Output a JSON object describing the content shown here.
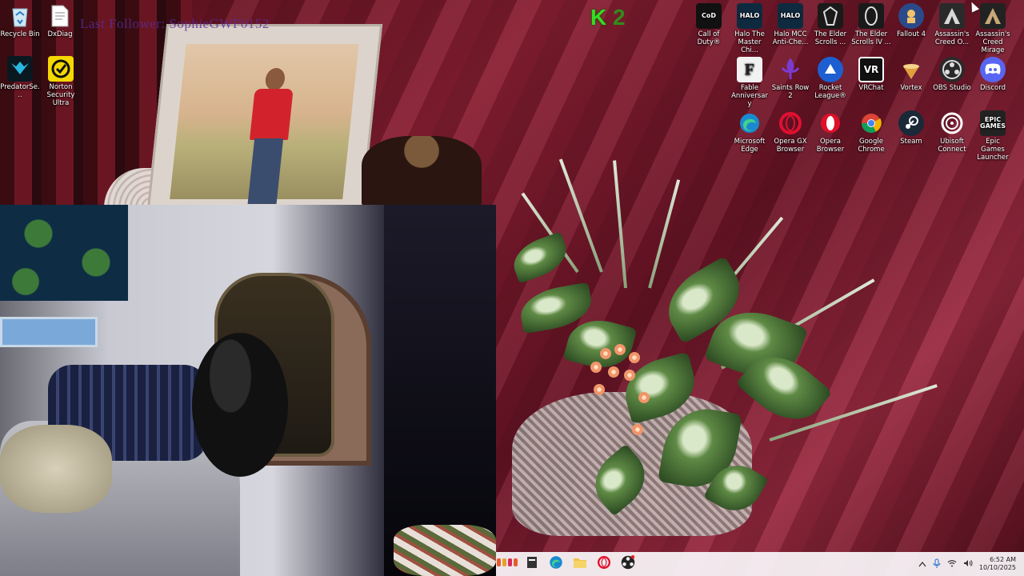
{
  "overlay": {
    "follower_text": "Last Follower: SophieGWF0152",
    "logo_letter": "K",
    "logo_number": "2"
  },
  "desktop_icons_left": [
    {
      "label": "Recycle Bin",
      "icon": "recycle-bin-icon"
    },
    {
      "label": "DxDiag",
      "icon": "document-icon"
    },
    {
      "label": "PredatorSe...",
      "icon": "predator-sense-icon"
    },
    {
      "label": "Norton Security Ultra",
      "icon": "norton-icon"
    }
  ],
  "desktop_icons_right": [
    {
      "label": "Call of Duty®",
      "icon": "call-of-duty-icon",
      "color": "#111111"
    },
    {
      "label": "Halo The Master Chi...",
      "icon": "halo-mcc-icon",
      "color": "#0f2a3f"
    },
    {
      "label": "Halo MCC Anti-Che...",
      "icon": "halo-anticheat-icon",
      "color": "#0f2a3f"
    },
    {
      "label": "The Elder Scrolls ...",
      "icon": "elder-scrolls-icon",
      "color": "#1a1a1a"
    },
    {
      "label": "The Elder Scrolls IV ...",
      "icon": "oblivion-icon",
      "color": "#1a1a1a"
    },
    {
      "label": "Fallout 4",
      "icon": "fallout4-icon",
      "color": "#2a4a8a"
    },
    {
      "label": "Assassin's Creed O...",
      "icon": "assassins-creed-odyssey-icon",
      "color": "#222222"
    },
    {
      "label": "Assassin's Creed Mirage",
      "icon": "assassins-creed-mirage-icon",
      "color": "#222222"
    },
    {
      "label": "Fable Anniversary",
      "icon": "fable-icon",
      "color": "#f2f2f2"
    },
    {
      "label": "Saints Row 2",
      "icon": "saints-row-icon",
      "color": "#5a1a8a"
    },
    {
      "label": "Rocket League®",
      "icon": "rocket-league-icon",
      "color": "#1d5fd0"
    },
    {
      "label": "VRChat",
      "icon": "vrchat-icon",
      "color": "#111111"
    },
    {
      "label": "Vortex",
      "icon": "vortex-icon",
      "color": "#e0a040"
    },
    {
      "label": "OBS Studio",
      "icon": "obs-icon",
      "color": "#2a2a2a"
    },
    {
      "label": "Discord",
      "icon": "discord-icon",
      "color": "#5865f2"
    },
    {
      "label": "Microsoft Edge",
      "icon": "edge-icon",
      "color": "#1a8ad0"
    },
    {
      "label": "Opera GX Browser",
      "icon": "opera-gx-icon",
      "color": "#e01030"
    },
    {
      "label": "Opera Browser",
      "icon": "opera-icon",
      "color": "#e0102a"
    },
    {
      "label": "Google Chrome",
      "icon": "chrome-icon",
      "color": "#2a9a3a"
    },
    {
      "label": "Steam",
      "icon": "steam-icon",
      "color": "#1b2838"
    },
    {
      "label": "Ubisoft Connect",
      "icon": "ubisoft-icon",
      "color": "#1a4aa0"
    },
    {
      "label": "Epic Games Launcher",
      "icon": "epic-games-icon",
      "color": "#222222"
    }
  ],
  "taskbar": {
    "apps": [
      {
        "name": "stream-widget-icon"
      },
      {
        "name": "file-icon"
      },
      {
        "name": "edge-icon"
      },
      {
        "name": "file-explorer-icon"
      },
      {
        "name": "opera-icon"
      },
      {
        "name": "obs-icon"
      }
    ],
    "clock_time": "6:52 AM",
    "clock_date": "10/10/2025"
  }
}
